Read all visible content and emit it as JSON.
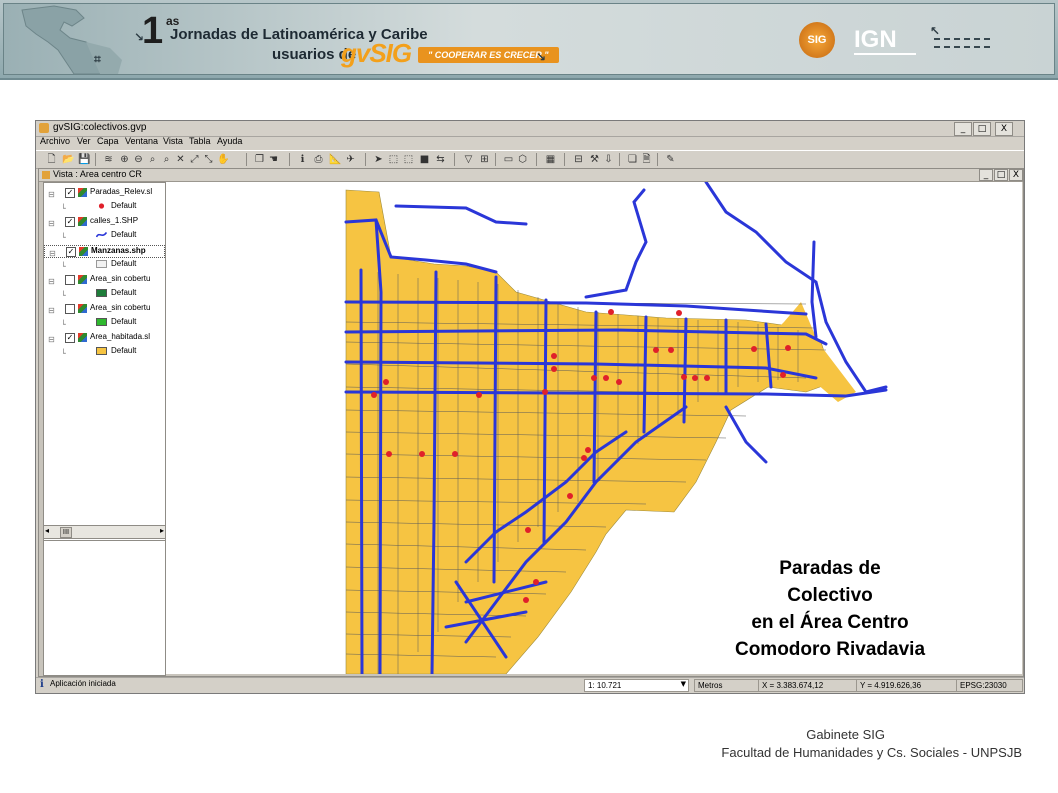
{
  "banner": {
    "ordinal": "1",
    "ordinal_suffix": "as",
    "line1": "Jornadas de Latinoamérica y Caribe",
    "line2_prefix": "usuarios de",
    "brand": "gvSIG",
    "motto": "\" COOPERAR ES CRECER \"",
    "gvsig_logo_text": "SIG",
    "ign_logo": "IGN"
  },
  "window": {
    "title": "gvSIG:colectivos.gvp",
    "controls": [
      "_",
      "□",
      "X"
    ]
  },
  "menu": [
    "Archivo",
    "Ver",
    "Capa",
    "Ventana",
    "Vista",
    "Tabla",
    "Ayuda"
  ],
  "view": {
    "title": "Vista : Area centro CR",
    "controls": [
      "_",
      "□",
      "X"
    ]
  },
  "toc": {
    "layers": [
      {
        "label": "Paradas_Relev.sl",
        "checked": true,
        "bold": false,
        "symbol": "point",
        "symbol_color": "#e0202a",
        "legend": "Default"
      },
      {
        "label": "calles_1.SHP",
        "checked": true,
        "bold": false,
        "symbol": "line",
        "symbol_color": "#2a36d8",
        "legend": "Default"
      },
      {
        "label": "Manzanas.shp",
        "checked": true,
        "bold": true,
        "symbol": "poly",
        "symbol_color": "#f2f2f2",
        "legend": "Default"
      },
      {
        "label": "Area_sin cobertu",
        "checked": false,
        "bold": false,
        "symbol": "poly",
        "symbol_color": "#1e7d3a",
        "legend": "Default"
      },
      {
        "label": "Area_sin cobertu",
        "checked": false,
        "bold": false,
        "symbol": "poly",
        "symbol_color": "#2eb82e",
        "legend": "Default"
      },
      {
        "label": "Area_habitada.sl",
        "checked": true,
        "bold": false,
        "symbol": "poly",
        "symbol_color": "#f6c442",
        "legend": "Default"
      }
    ],
    "scroll_thumb": "III"
  },
  "map": {
    "fill_color": "#f6c442",
    "street_color": "#2a36d8",
    "stop_color": "#e0202a"
  },
  "overlay": {
    "line1": "Paradas de",
    "line2": "Colectivo",
    "line3": "en el Área Centro",
    "line4": "Comodoro Rivadavia"
  },
  "status": {
    "message": "Aplicación iniciada",
    "scale": "1: 10.721",
    "units": "Metros",
    "x": "X = 3.383.674,12",
    "y": "Y = 4.919.626,36",
    "epsg": "EPSG:23030"
  },
  "footer": {
    "line1": "Gabinete SIG",
    "line2": "Facultad de Humanidades y Cs. Sociales - UNPSJB"
  }
}
